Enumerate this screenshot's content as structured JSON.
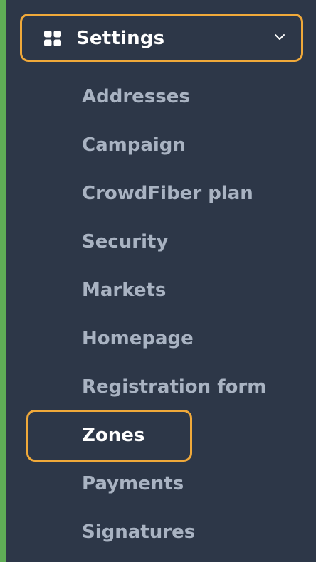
{
  "header": {
    "icon": "grid-icon",
    "label": "Settings",
    "chevron": "chevron-down-icon"
  },
  "menu": {
    "items": [
      {
        "label": "Addresses",
        "active": false
      },
      {
        "label": "Campaign",
        "active": false
      },
      {
        "label": "CrowdFiber plan",
        "active": false
      },
      {
        "label": "Security",
        "active": false
      },
      {
        "label": "Markets",
        "active": false
      },
      {
        "label": "Homepage",
        "active": false
      },
      {
        "label": "Registration form",
        "active": false
      },
      {
        "label": "Zones",
        "active": true
      },
      {
        "label": "Payments",
        "active": false
      },
      {
        "label": "Signatures",
        "active": false
      }
    ]
  },
  "colors": {
    "background": "#2d3748",
    "accent_bar": "#5fad56",
    "highlight_border": "#f0a93a",
    "inactive_text": "#a9b3c2",
    "active_text": "#ffffff"
  }
}
